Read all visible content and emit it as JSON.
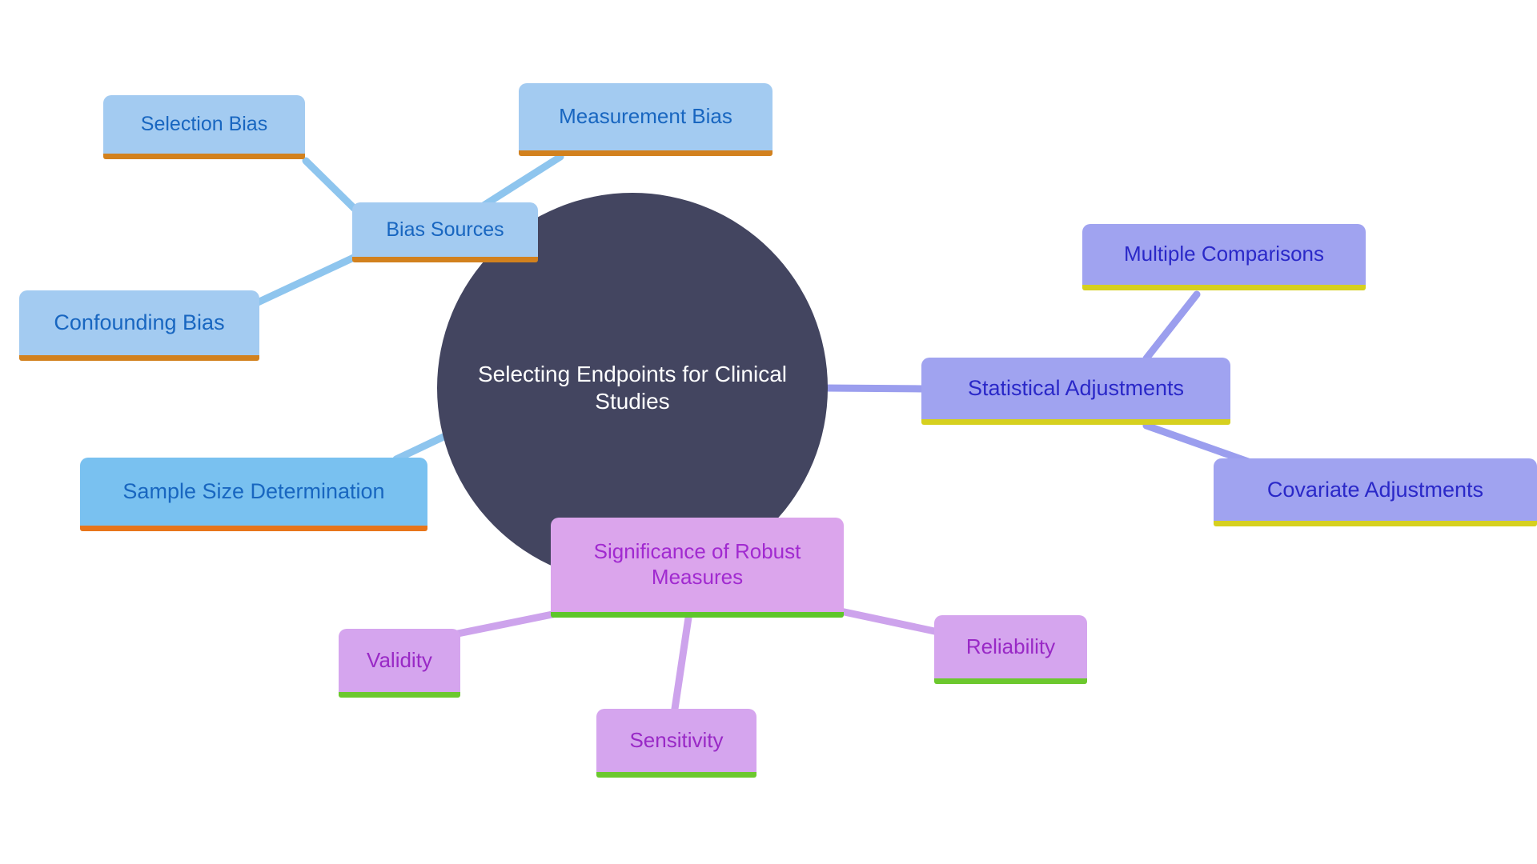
{
  "diagram": {
    "type": "mind-map",
    "background": "#ffffff",
    "root": {
      "label": "Selecting Endpoints for Clinical Studies",
      "fill": "#434560",
      "text_color": "#ffffff"
    },
    "branches": [
      {
        "id": "bias-sources",
        "label": "Bias Sources",
        "fill": "#a3cbf1",
        "text_color": "#1866c0",
        "accent": "#d2811e",
        "children": [
          {
            "id": "selection-bias",
            "label": "Selection Bias"
          },
          {
            "id": "measurement-bias",
            "label": "Measurement Bias"
          },
          {
            "id": "confounding-bias",
            "label": "Confounding Bias"
          }
        ]
      },
      {
        "id": "sample-size-determination",
        "label": "Sample Size Determination",
        "fill": "#79c1f0",
        "text_color": "#1866c0",
        "accent": "#e8751a",
        "children": []
      },
      {
        "id": "statistical-adjustments",
        "label": "Statistical Adjustments",
        "fill": "#a0a3f0",
        "text_color": "#2a28c8",
        "accent": "#d6d01f",
        "children": [
          {
            "id": "multiple-comparisons",
            "label": "Multiple Comparisons"
          },
          {
            "id": "covariate-adjustments",
            "label": "Covariate Adjustments"
          }
        ]
      },
      {
        "id": "significance-of-robust-measures",
        "label": "Significance of Robust Measures",
        "fill": "#dba5ec",
        "text_color": "#a12ad0",
        "accent": "#5ec62a",
        "children": [
          {
            "id": "validity",
            "label": "Validity"
          },
          {
            "id": "sensitivity",
            "label": "Sensitivity"
          },
          {
            "id": "reliability",
            "label": "Reliability"
          }
        ]
      }
    ],
    "nodes": {
      "root": "Selecting Endpoints for Clinical\nStudies",
      "bias_sources": "Bias Sources",
      "selection_bias": "Selection Bias",
      "measurement_bias": "Measurement Bias",
      "confounding_bias": "Confounding Bias",
      "sample_size": "Sample Size Determination",
      "statistical_adjustments": "Statistical Adjustments",
      "multiple_comparisons": "Multiple Comparisons",
      "covariate_adjustments": "Covariate Adjustments",
      "robust_measures": "Significance of Robust\nMeasures",
      "validity": "Validity",
      "sensitivity": "Sensitivity",
      "reliability": "Reliability"
    },
    "edges": [
      {
        "from": "root",
        "to": "bias_sources",
        "color": "#8ec5ee"
      },
      {
        "from": "bias_sources",
        "to": "selection_bias",
        "color": "#8ec5ee"
      },
      {
        "from": "bias_sources",
        "to": "measurement_bias",
        "color": "#8ec5ee"
      },
      {
        "from": "bias_sources",
        "to": "confounding_bias",
        "color": "#8ec5ee"
      },
      {
        "from": "root",
        "to": "sample_size",
        "color": "#8ec5ee"
      },
      {
        "from": "root",
        "to": "statistical_adjustments",
        "color": "#9b9eee"
      },
      {
        "from": "statistical_adjustments",
        "to": "multiple_comparisons",
        "color": "#9b9eee"
      },
      {
        "from": "statistical_adjustments",
        "to": "covariate_adjustments",
        "color": "#9b9eee"
      },
      {
        "from": "root",
        "to": "robust_measures",
        "color": "#cda3ec"
      },
      {
        "from": "robust_measures",
        "to": "validity",
        "color": "#cda3ec"
      },
      {
        "from": "robust_measures",
        "to": "sensitivity",
        "color": "#cda3ec"
      },
      {
        "from": "robust_measures",
        "to": "reliability",
        "color": "#cda3ec"
      }
    ]
  }
}
